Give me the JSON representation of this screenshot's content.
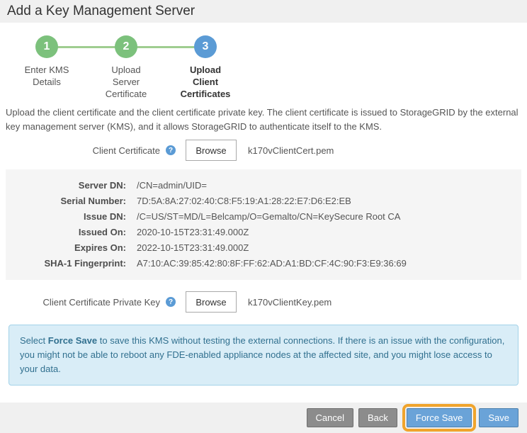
{
  "title": "Add a Key Management Server",
  "stepper": {
    "steps": [
      {
        "number": "1",
        "label": "Enter KMS\nDetails",
        "state": "complete"
      },
      {
        "number": "2",
        "label": "Upload\nServer\nCertificate",
        "state": "complete"
      },
      {
        "number": "3",
        "label": "Upload\nClient\nCertificates",
        "state": "current"
      }
    ]
  },
  "description": "Upload the client certificate and the client certificate private key. The client certificate is issued to StorageGRID by the external key management server (KMS), and it allows StorageGRID to authenticate itself to the KMS.",
  "client_certificate": {
    "label": "Client Certificate",
    "help_icon": "question-mark-help-icon",
    "browse_label": "Browse",
    "filename": "k170vClientCert.pem"
  },
  "certificate_details": {
    "rows": [
      {
        "label": "Server DN:",
        "value": "/CN=admin/UID="
      },
      {
        "label": "Serial Number:",
        "value": "7D:5A:8A:27:02:40:C8:F5:19:A1:28:22:E7:D6:E2:EB"
      },
      {
        "label": "Issue DN:",
        "value": "/C=US/ST=MD/L=Belcamp/O=Gemalto/CN=KeySecure Root CA"
      },
      {
        "label": "Issued On:",
        "value": "2020-10-15T23:31:49.000Z"
      },
      {
        "label": "Expires On:",
        "value": "2022-10-15T23:31:49.000Z"
      },
      {
        "label": "SHA-1 Fingerprint:",
        "value": "A7:10:AC:39:85:42:80:8F:FF:62:AD:A1:BD:CF:4C:90:F3:E9:36:69"
      }
    ]
  },
  "private_key": {
    "label": "Client Certificate Private Key",
    "help_icon": "question-mark-help-icon",
    "browse_label": "Browse",
    "filename": "k170vClientKey.pem"
  },
  "info_box": {
    "prefix": "Select ",
    "bold": "Force Save",
    "suffix": " to save this KMS without testing the external connections. If there is an issue with the configuration, you might not be able to reboot any FDE-enabled appliance nodes at the affected site, and you might lose access to your data."
  },
  "footer": {
    "cancel_label": "Cancel",
    "back_label": "Back",
    "force_save_label": "Force Save",
    "save_label": "Save"
  },
  "colors": {
    "step_complete_green": "#7cc17c",
    "step_current_blue": "#5b9bd5",
    "connector_green": "#9fcd90",
    "button_blue": "#6aa3d8",
    "button_gray": "#8c8c8c",
    "highlight_orange": "#f0a42c",
    "info_background": "#d9edf7",
    "info_text": "#31708f",
    "panel_gray": "#f5f5f5",
    "bar_gray": "#f0f0f0"
  }
}
